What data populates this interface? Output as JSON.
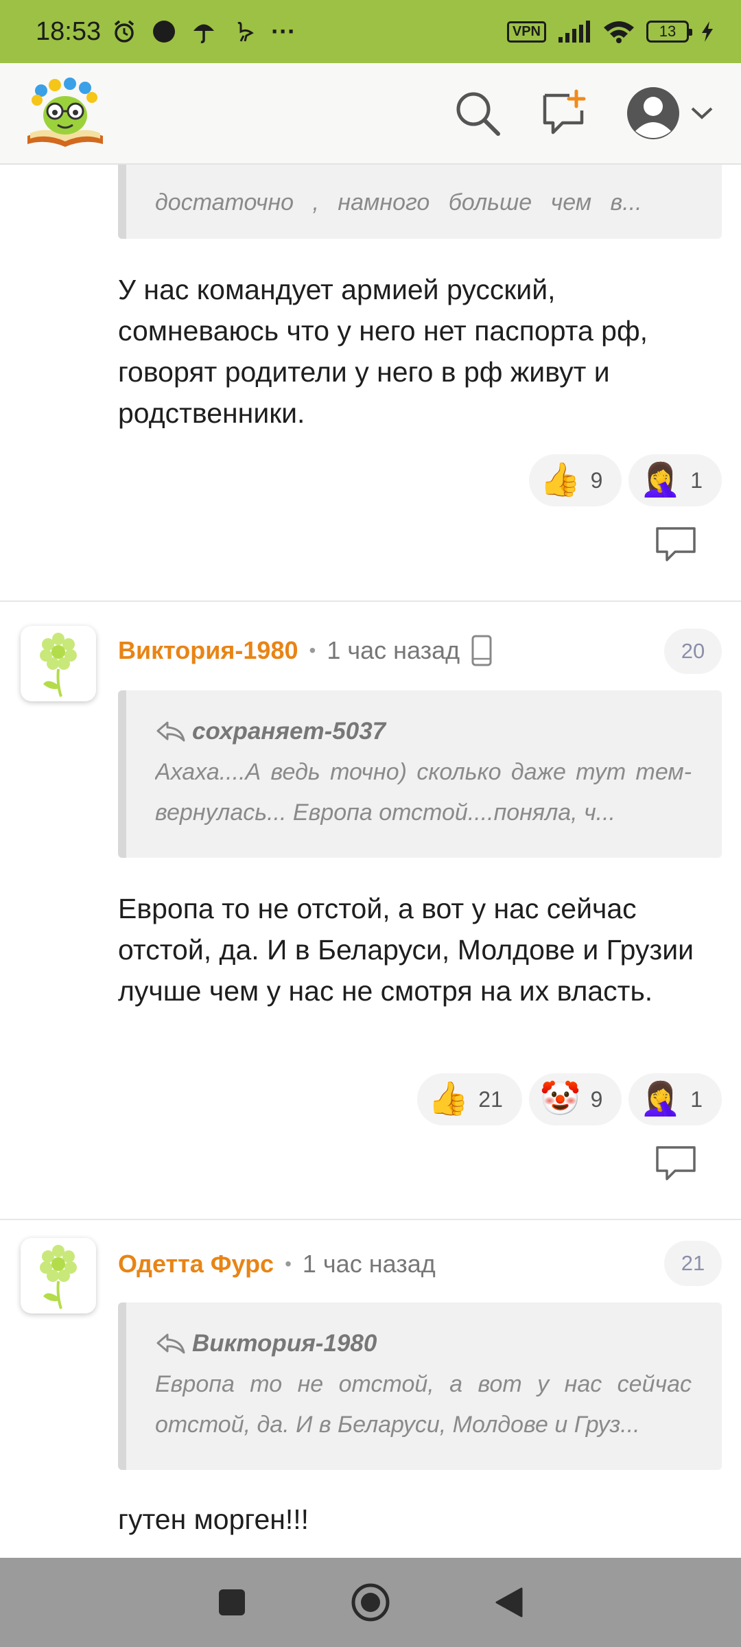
{
  "status_bar": {
    "time": "18:53",
    "vpn": "VPN",
    "battery": "13",
    "icons": [
      "alarm-icon",
      "circle-icon",
      "umbrella-icon",
      "ostrich-icon",
      "more-dots-icon",
      "signal-icon",
      "wifi-icon",
      "charging-icon"
    ],
    "more": "···"
  },
  "header": {
    "actions": [
      "search-icon",
      "new-post-icon",
      "profile-icon",
      "chevron-down-icon"
    ]
  },
  "partial_comment": {
    "quote_text_line": "достаточно , намного больше чем в...",
    "text": "У нас командует армией русский, сомневаюсь что у него нет паспорта рф, говорят родители у него в рф живут и родственники.",
    "reactions": [
      {
        "emoji": "👍",
        "count": "9"
      },
      {
        "emoji": "🤦‍♀️",
        "count": "1"
      }
    ]
  },
  "comments": [
    {
      "author": "Виктория-1980",
      "time": "1 час назад",
      "number": "20",
      "quote_author": "сохраняет-5037",
      "quote_text": "Ахаха....А ведь точно) сколько даже тут тем-вернулась... Европа отстой....поняла, ч...",
      "text": "Европа то не отстой, а вот у нас сейчас отстой, да. И в Беларуси, Молдове и Грузии лучше чем у нас не смотря на их власть.",
      "reactions": [
        {
          "emoji": "👍",
          "count": "21"
        },
        {
          "emoji": "🤡",
          "count": "9"
        },
        {
          "emoji": "🤦‍♀️",
          "count": "1"
        }
      ]
    },
    {
      "author": "Одетта Фурс",
      "time": "1 час назад",
      "number": "21",
      "quote_author": "Виктория-1980",
      "quote_text": "Европа то не отстой, а вот у нас сейчас отстой, да. И в Беларуси, Молдове и Груз...",
      "text": "гутен морген!!!"
    }
  ],
  "nav": [
    "recents-button",
    "home-button",
    "back-button"
  ],
  "colors": {
    "status_bar": "#9cc144",
    "author": "#e88415",
    "nav_bar": "#9b9b9b"
  }
}
